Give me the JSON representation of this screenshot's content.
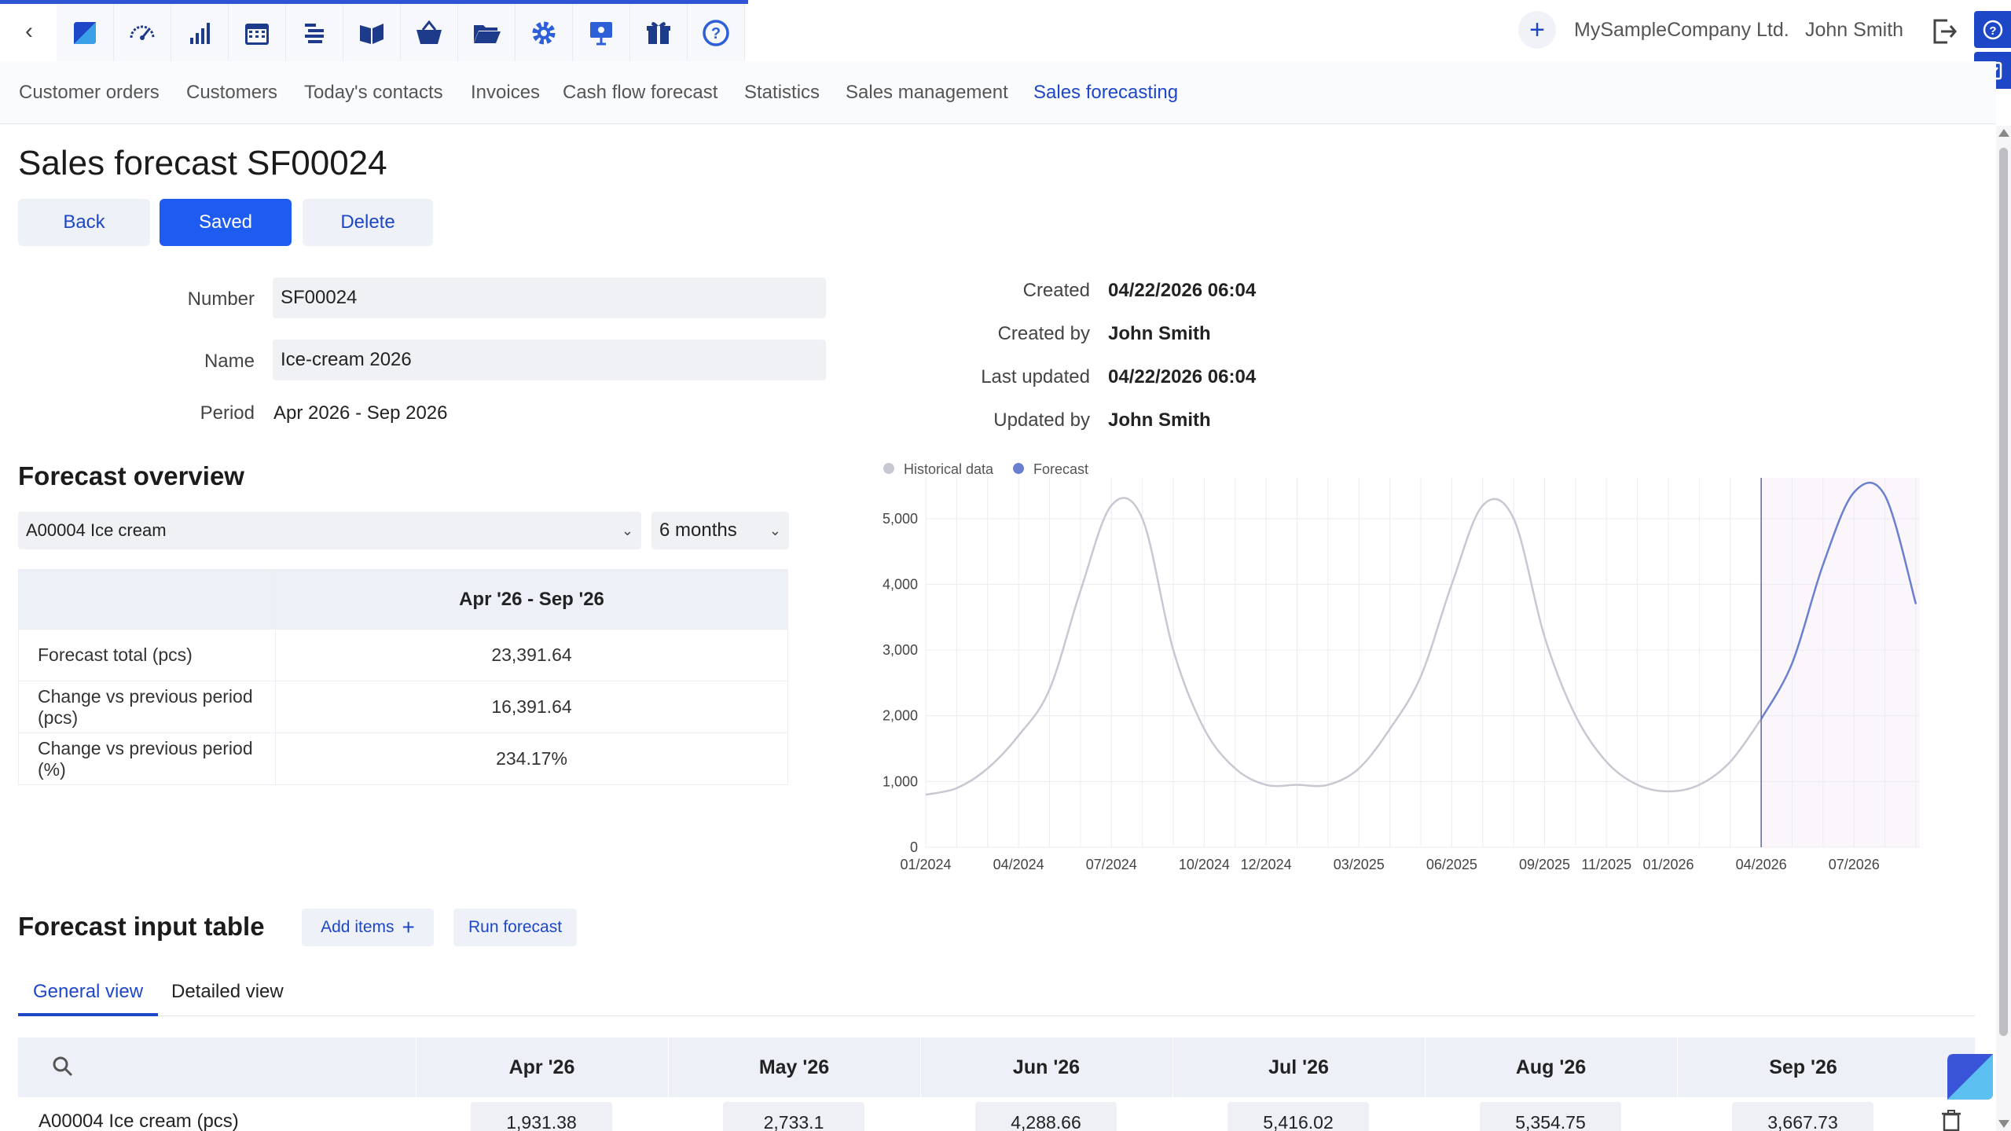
{
  "topbar": {
    "icons": [
      "logo-icon",
      "dashboard-icon",
      "statistics-icon",
      "calendar-icon",
      "list-icon",
      "book-icon",
      "basket-icon",
      "folder-icon",
      "gear-icon",
      "presentation-icon",
      "gift-icon",
      "help-icon"
    ],
    "company": "MySampleCompany Ltd.",
    "user": "John Smith"
  },
  "nav": {
    "items": [
      "Customer orders",
      "Customers",
      "Today's contacts",
      "Invoices",
      "Cash flow forecast",
      "Statistics",
      "Sales management",
      "Sales forecasting"
    ],
    "active": "Sales forecasting"
  },
  "page": {
    "title": "Sales forecast SF00024",
    "buttons": {
      "back": "Back",
      "saved": "Saved",
      "delete": "Delete"
    }
  },
  "form": {
    "number_label": "Number",
    "number_value": "SF00024",
    "name_label": "Name",
    "name_value": "Ice-cream 2026",
    "period_label": "Period",
    "period_value": "Apr 2026 - Sep 2026"
  },
  "meta": {
    "created_label": "Created",
    "created_value": "04/22/2026 06:04",
    "created_by_label": "Created by",
    "created_by_value": "John Smith",
    "updated_label": "Last updated",
    "updated_value": "04/22/2026 06:04",
    "updated_by_label": "Updated by",
    "updated_by_value": "John Smith"
  },
  "overview": {
    "title": "Forecast overview",
    "item_select": "A00004 Ice cream",
    "period_select": "6 months",
    "column_header": "Apr '26 - Sep '26",
    "rows": [
      {
        "label": "Forecast total (pcs)",
        "value": "23,391.64"
      },
      {
        "label": "Change vs previous period (pcs)",
        "value": "16,391.64"
      },
      {
        "label": "Change vs previous period (%)",
        "value": "234.17%"
      }
    ]
  },
  "chart_data": {
    "type": "line",
    "legend": [
      "Historical data",
      "Forecast"
    ],
    "legend_position": "top-left",
    "colors": {
      "historical": "#c8c8d2",
      "forecast": "#6a7fcf"
    },
    "yticks": [
      "0",
      "1,000",
      "2,000",
      "3,000",
      "4,000",
      "5,000"
    ],
    "ylim": [
      0,
      5500
    ],
    "xticks": [
      {
        "label": "01/2024",
        "t": 0
      },
      {
        "label": "04/2024",
        "t": 3
      },
      {
        "label": "07/2024",
        "t": 6
      },
      {
        "label": "10/2024",
        "t": 9
      },
      {
        "label": "12/2024",
        "t": 11
      },
      {
        "label": "03/2025",
        "t": 14
      },
      {
        "label": "06/2025",
        "t": 17
      },
      {
        "label": "09/2025",
        "t": 20
      },
      {
        "label": "11/2025",
        "t": 22
      },
      {
        "label": "01/2026",
        "t": 24
      },
      {
        "label": "04/2026",
        "t": 27
      },
      {
        "label": "07/2026",
        "t": 30
      }
    ],
    "xlim": [
      0,
      32
    ],
    "grid": true,
    "forecast_start": 27,
    "series": [
      {
        "name": "Historical data",
        "points": [
          [
            0,
            800
          ],
          [
            1,
            900
          ],
          [
            2,
            1200
          ],
          [
            3,
            1700
          ],
          [
            4,
            2400
          ],
          [
            5,
            3900
          ],
          [
            6,
            5200
          ],
          [
            7,
            5000
          ],
          [
            8,
            3000
          ],
          [
            9,
            1800
          ],
          [
            10,
            1200
          ],
          [
            11,
            950
          ],
          [
            12,
            950
          ],
          [
            13,
            950
          ],
          [
            14,
            1200
          ],
          [
            15,
            1800
          ],
          [
            16,
            2600
          ],
          [
            17,
            4000
          ],
          [
            18,
            5200
          ],
          [
            19,
            5000
          ],
          [
            20,
            3200
          ],
          [
            21,
            2000
          ],
          [
            22,
            1300
          ],
          [
            23,
            950
          ],
          [
            24,
            850
          ],
          [
            25,
            950
          ],
          [
            26,
            1300
          ],
          [
            27,
            1950
          ]
        ]
      },
      {
        "name": "Forecast",
        "points": [
          [
            27,
            1950
          ],
          [
            28,
            2800
          ],
          [
            29,
            4300
          ],
          [
            30,
            5400
          ],
          [
            31,
            5350
          ],
          [
            32,
            3700
          ]
        ]
      }
    ]
  },
  "input_table": {
    "title": "Forecast input table",
    "add_items": "Add items",
    "run_forecast": "Run forecast",
    "tabs": [
      "General view",
      "Detailed view"
    ],
    "months": [
      "Apr '26",
      "May '26",
      "Jun '26",
      "Jul '26",
      "Aug '26",
      "Sep '26"
    ],
    "row_label": "A00004 Ice cream (pcs)",
    "values": [
      "1,931.38",
      "2,733.1",
      "4,288.66",
      "5,416.02",
      "5,354.75",
      "3,667.73"
    ]
  }
}
